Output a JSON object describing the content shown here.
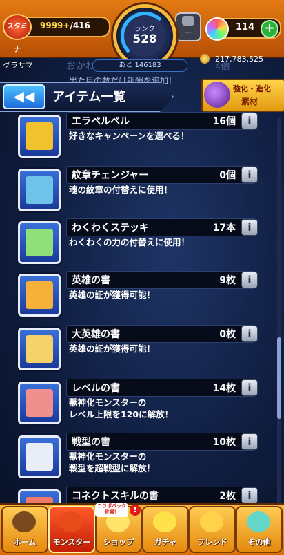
{
  "status": {
    "stamina_label": "スタミナ",
    "stamina_current": "9999+",
    "stamina_max": "/416",
    "rank_label": "ランク",
    "rank_value": "528",
    "next_exp": "あと 146183",
    "device_text": "---",
    "orb_count": "114",
    "owner_name": "グラサマ",
    "coins": "217,783,525"
  },
  "background_hidden": {
    "peek_name": "おかわ",
    "peek_count": "4個",
    "notice": "出た目の数だけ報酬を追加！"
  },
  "header": {
    "back_icon": "◀◀",
    "title": "アイテム一覧",
    "evo_line1": "強化・進化",
    "evo_line2": "素材"
  },
  "items": [
    {
      "name": "エラベルベル",
      "count": "16個",
      "desc": "好きなキャンペーンを選べる！",
      "icon": "bell-icon",
      "color": "#f2c22e"
    },
    {
      "name": "紋章チェンジャー",
      "count": "0個",
      "desc": "魂の紋章の付替えに使用！",
      "icon": "emblem-icon",
      "color": "#6fc3e8"
    },
    {
      "name": "わくわくステッキ",
      "count": "17本",
      "desc": "わくわくの力の付替えに使用！",
      "icon": "wand-icon",
      "color": "#8fe07a"
    },
    {
      "name": "英雄の書",
      "count": "9枚",
      "desc": "英雄の証が獲得可能！",
      "icon": "scroll-icon",
      "color": "#f5b13a"
    },
    {
      "name": "大英雄の書",
      "count": "0枚",
      "desc": "英雄の証が獲得可能！",
      "icon": "scroll-icon",
      "color": "#f5d36a"
    },
    {
      "name": "レベルの書",
      "count": "14枚",
      "desc": "獣神化モンスターの\nレベル上限を120に解放！",
      "icon": "scroll-icon",
      "color": "#f0908e"
    },
    {
      "name": "戦型の書",
      "count": "10枚",
      "desc": "獣神化モンスターの\n戦型を超戦型に解放！",
      "icon": "scroll-icon",
      "color": "#e9eef6"
    },
    {
      "name": "コネクトスキルの書",
      "count": "2枚",
      "desc": "",
      "icon": "scroll-icon",
      "color": "#f07a6a"
    }
  ],
  "info_label": "i",
  "nav": {
    "collab_badge": "コラボパック登場！",
    "alert": "!",
    "items": [
      {
        "label": "ホーム",
        "icon": "home-icon"
      },
      {
        "label": "モンスター",
        "icon": "monster-icon"
      },
      {
        "label": "ショップ",
        "icon": "shop-icon"
      },
      {
        "label": "ガチャ",
        "icon": "gacha-icon"
      },
      {
        "label": "フレンド",
        "icon": "friend-icon"
      },
      {
        "label": "その他",
        "icon": "other-icon"
      }
    ]
  }
}
